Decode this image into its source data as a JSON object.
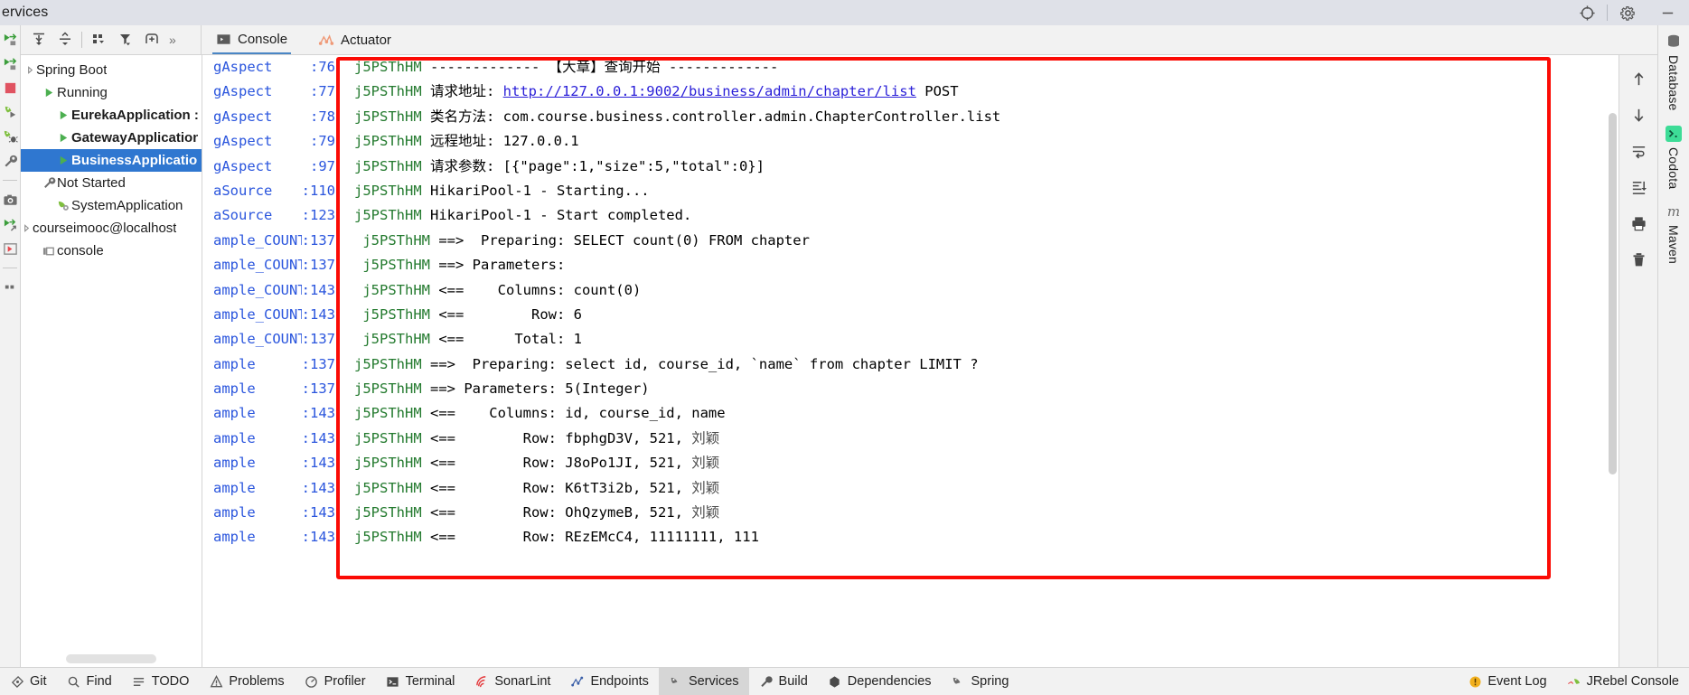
{
  "window": {
    "title": "ervices",
    "buttons": {
      "locate": "locate-icon",
      "settings": "settings-icon",
      "minimize": "minimize-icon"
    }
  },
  "left_rail": {
    "icons": [
      "run-icon",
      "rerun-icon",
      "stop-icon",
      "run-arrow-icon",
      "debug-icon",
      "wrench-icon",
      "camera-icon",
      "rerun-failed-icon",
      "resume-icon",
      "more-icon"
    ]
  },
  "toolbar": {
    "buttons": [
      "expand-all-icon",
      "collapse-all-icon",
      "group-by-icon",
      "filter-icon",
      "add-service-icon"
    ],
    "overflow": "»"
  },
  "tabs": [
    {
      "label": "Console",
      "icon": "console-icon",
      "active": true
    },
    {
      "label": "Actuator",
      "icon": "actuator-icon",
      "active": false
    }
  ],
  "tree": {
    "nodes": [
      {
        "label": "Spring Boot",
        "indent": 0,
        "icon": "spring-icon",
        "twisty": "collapsed",
        "bold": false,
        "selected": false
      },
      {
        "label": "Running",
        "indent": 1,
        "icon": "run-green-icon",
        "twisty": "none",
        "bold": false,
        "selected": false
      },
      {
        "label": "EurekaApplication :",
        "indent": 2,
        "icon": "run-green-icon",
        "twisty": "none",
        "bold": true,
        "selected": false
      },
      {
        "label": "GatewayApplication",
        "indent": 2,
        "icon": "run-green-icon",
        "twisty": "none",
        "bold": true,
        "selected": false
      },
      {
        "label": "BusinessApplication",
        "indent": 2,
        "icon": "run-green-icon",
        "twisty": "none",
        "bold": true,
        "selected": true
      },
      {
        "label": "Not Started",
        "indent": 1,
        "icon": "wrench-icon",
        "twisty": "none",
        "bold": false,
        "selected": false
      },
      {
        "label": "SystemApplication",
        "indent": 2,
        "icon": "spring-leaf-icon",
        "twisty": "none",
        "bold": false,
        "selected": false
      },
      {
        "label": "courseimooc@localhost",
        "indent": 0,
        "icon": "db-icon",
        "twisty": "none",
        "bold": false,
        "selected": false
      },
      {
        "label": "console",
        "indent": 1,
        "icon": "console-small-icon",
        "twisty": "none",
        "bold": false,
        "selected": false
      }
    ]
  },
  "console": {
    "lines": [
      {
        "source": "gAspect",
        "line": ":76",
        "thread": "j5PSThHM",
        "segments": [
          {
            "text": " ------------- 【大章】查询开始 -------------",
            "style": "text"
          }
        ]
      },
      {
        "source": "gAspect",
        "line": ":77",
        "thread": "j5PSThHM",
        "segments": [
          {
            "text": " 请求地址: ",
            "style": "text"
          },
          {
            "text": "http://127.0.0.1:9002/business/admin/chapter/list",
            "style": "link"
          },
          {
            "text": " POST",
            "style": "text"
          }
        ]
      },
      {
        "source": "gAspect",
        "line": ":78",
        "thread": "j5PSThHM",
        "segments": [
          {
            "text": " 类名方法: com.course.business.controller.admin.ChapterController.list",
            "style": "text"
          }
        ]
      },
      {
        "source": "gAspect",
        "line": ":79",
        "thread": "j5PSThHM",
        "segments": [
          {
            "text": " 远程地址: 127.0.0.1",
            "style": "text"
          }
        ]
      },
      {
        "source": "gAspect",
        "line": ":97",
        "thread": "j5PSThHM",
        "segments": [
          {
            "text": " 请求参数: [{\"page\":1,\"size\":5,\"total\":0}]",
            "style": "text"
          }
        ]
      },
      {
        "source": "aSource",
        "line": ":110",
        "thread": "j5PSThHM",
        "segments": [
          {
            "text": " HikariPool-1 - Starting...",
            "style": "text"
          }
        ]
      },
      {
        "source": "aSource",
        "line": ":123",
        "thread": "j5PSThHM",
        "segments": [
          {
            "text": " HikariPool-1 - Start completed.",
            "style": "text"
          }
        ]
      },
      {
        "source": "ample_COUNT",
        "line": ":137",
        "thread": " j5PSThHM",
        "segments": [
          {
            "text": " ==>  Preparing: SELECT count(0) FROM chapter",
            "style": "text"
          }
        ]
      },
      {
        "source": "ample_COUNT",
        "line": ":137",
        "thread": " j5PSThHM",
        "segments": [
          {
            "text": " ==> Parameters:",
            "style": "text"
          }
        ]
      },
      {
        "source": "ample_COUNT",
        "line": ":143",
        "thread": " j5PSThHM",
        "segments": [
          {
            "text": " <==    Columns: count(0)",
            "style": "text"
          }
        ]
      },
      {
        "source": "ample_COUNT",
        "line": ":143",
        "thread": " j5PSThHM",
        "segments": [
          {
            "text": " <==        Row: 6",
            "style": "text"
          }
        ]
      },
      {
        "source": "ample_COUNT",
        "line": ":137",
        "thread": " j5PSThHM",
        "segments": [
          {
            "text": " <==      Total: 1",
            "style": "text"
          }
        ]
      },
      {
        "source": "ample",
        "line": ":137",
        "thread": "j5PSThHM",
        "segments": [
          {
            "text": " ==>  Preparing: select id, course_id, `name` from chapter LIMIT ?",
            "style": "text"
          }
        ]
      },
      {
        "source": "ample",
        "line": ":137",
        "thread": "j5PSThHM",
        "segments": [
          {
            "text": " ==> Parameters: 5(Integer)",
            "style": "text"
          }
        ]
      },
      {
        "source": "ample",
        "line": ":143",
        "thread": "j5PSThHM",
        "segments": [
          {
            "text": " <==    Columns: id, course_id, name",
            "style": "text"
          }
        ]
      },
      {
        "source": "ample",
        "line": ":143",
        "thread": "j5PSThHM",
        "segments": [
          {
            "text": " <==        Row: fbphgD3V, 521, ",
            "style": "text"
          },
          {
            "text": "刘颖",
            "style": "cjk"
          }
        ]
      },
      {
        "source": "ample",
        "line": ":143",
        "thread": "j5PSThHM",
        "segments": [
          {
            "text": " <==        Row: J8oPo1JI, 521, ",
            "style": "text"
          },
          {
            "text": "刘颖",
            "style": "cjk"
          }
        ]
      },
      {
        "source": "ample",
        "line": ":143",
        "thread": "j5PSThHM",
        "segments": [
          {
            "text": " <==        Row: K6tT3i2b, 521, ",
            "style": "text"
          },
          {
            "text": "刘颖",
            "style": "cjk"
          }
        ]
      },
      {
        "source": "ample",
        "line": ":143",
        "thread": "j5PSThHM",
        "segments": [
          {
            "text": " <==        Row: OhQzymeB, 521, ",
            "style": "text"
          },
          {
            "text": "刘颖",
            "style": "cjk"
          }
        ]
      },
      {
        "source": "ample",
        "line": ":143",
        "thread": "j5PSThHM",
        "segments": [
          {
            "text": " <==        Row: REzEMcC4, 11111111, 111",
            "style": "text"
          }
        ]
      }
    ],
    "highlight_color": "#fb0b05",
    "right_toolbar": [
      "scroll-up-icon",
      "scroll-down-icon",
      "soft-wrap-icon",
      "scroll-to-end-icon",
      "print-icon",
      "delete-icon"
    ]
  },
  "right_rail": [
    {
      "label": "Database",
      "icon": "database-icon"
    },
    {
      "label": "Codota",
      "icon": "codota-icon"
    },
    {
      "label": "Maven",
      "icon": "maven-icon"
    }
  ],
  "status_bar": {
    "left": [
      {
        "label": "Git",
        "icon": "git-icon",
        "active": false
      },
      {
        "label": "Find",
        "icon": "find-icon",
        "active": false
      },
      {
        "label": "TODO",
        "icon": "todo-icon",
        "active": false
      },
      {
        "label": "Problems",
        "icon": "problems-icon",
        "active": false
      },
      {
        "label": "Profiler",
        "icon": "profiler-icon",
        "active": false
      },
      {
        "label": "Terminal",
        "icon": "terminal-icon",
        "active": false
      },
      {
        "label": "SonarLint",
        "icon": "sonarlint-icon",
        "active": false
      },
      {
        "label": "Endpoints",
        "icon": "endpoints-icon",
        "active": false
      },
      {
        "label": "Services",
        "icon": "services-icon",
        "active": true
      },
      {
        "label": "Build",
        "icon": "build-icon",
        "active": false
      },
      {
        "label": "Dependencies",
        "icon": "dependencies-icon",
        "active": false
      },
      {
        "label": "Spring",
        "icon": "spring-icon",
        "active": false
      }
    ],
    "right": [
      {
        "label": "Event Log",
        "icon": "event-log-icon",
        "active": false
      },
      {
        "label": "JRebel Console",
        "icon": "jrebel-icon",
        "active": false
      }
    ]
  }
}
